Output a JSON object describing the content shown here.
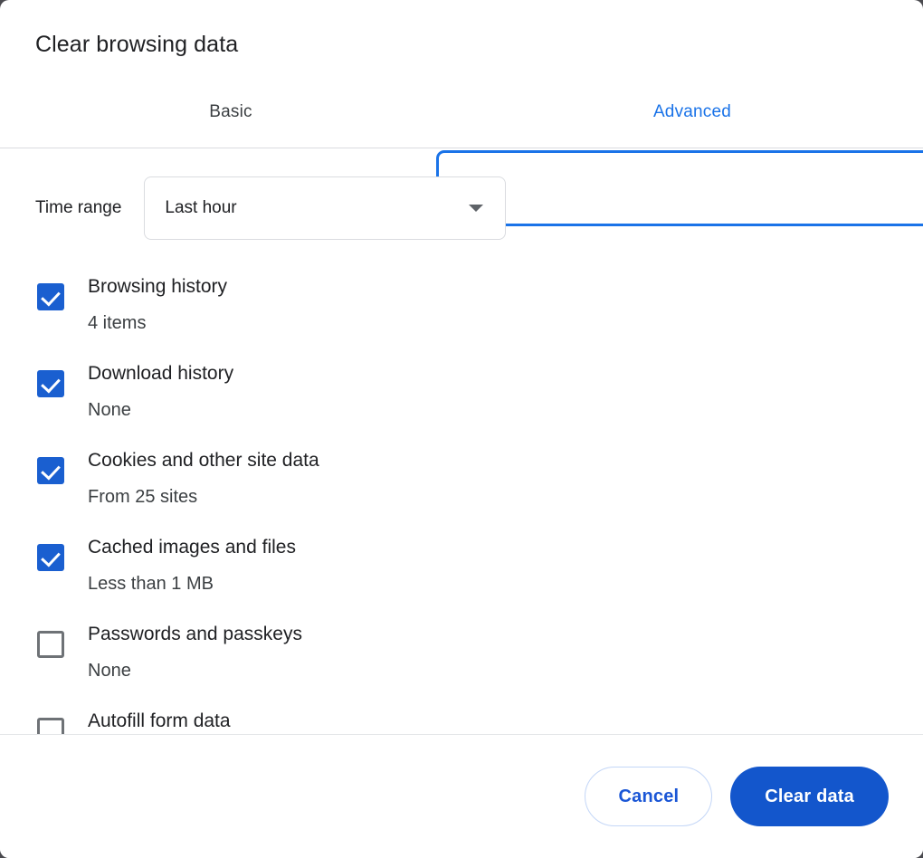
{
  "dialog": {
    "title": "Clear browsing data"
  },
  "tabs": [
    {
      "id": "basic",
      "label": "Basic",
      "selected": false
    },
    {
      "id": "advanced",
      "label": "Advanced",
      "selected": true
    }
  ],
  "time_range": {
    "label": "Time range",
    "selected": "Last hour",
    "caret_icon": "chevron-down-icon"
  },
  "items": [
    {
      "label": "Browsing history",
      "sub": "4 items",
      "checked": true
    },
    {
      "label": "Download history",
      "sub": "None",
      "checked": true
    },
    {
      "label": "Cookies and other site data",
      "sub": "From 25 sites",
      "checked": true
    },
    {
      "label": "Cached images and files",
      "sub": "Less than 1 MB",
      "checked": true
    },
    {
      "label": "Passwords and passkeys",
      "sub": "None",
      "checked": false
    },
    {
      "label": "Autofill form data",
      "sub": "",
      "checked": false
    }
  ],
  "footer": {
    "cancel_label": "Cancel",
    "confirm_label": "Clear data"
  },
  "colors": {
    "accent": "#1a73e8",
    "primary_button": "#1356cc",
    "checkbox_on": "#1a5fd0",
    "checkbox_off_border": "#6e7276",
    "text_primary": "#202124",
    "text_secondary": "#3c4043",
    "divider": "#dadce0",
    "backdrop": "#4a4a4f"
  }
}
